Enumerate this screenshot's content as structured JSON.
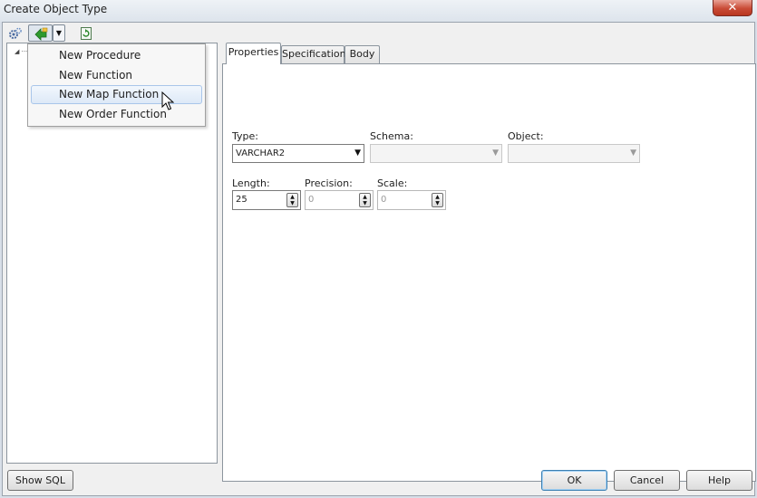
{
  "window": {
    "title": "Create Object Type",
    "close_glyph": "✕"
  },
  "toolbar": {
    "icons": [
      "settings-gear-icon",
      "add-method-icon",
      "dropdown-arrow-icon",
      "refresh-icon"
    ]
  },
  "menu": {
    "items": [
      {
        "label": "New Procedure"
      },
      {
        "label": "New Function"
      },
      {
        "label": "New Map Function"
      },
      {
        "label": "New Order Function"
      }
    ],
    "hovered_index": 2
  },
  "tabs": [
    {
      "label": "Properties",
      "active": true
    },
    {
      "label": "Specification",
      "active": false
    },
    {
      "label": "Body",
      "active": false
    }
  ],
  "properties": {
    "type_label": "Type:",
    "type_value": "VARCHAR2",
    "schema_label": "Schema:",
    "schema_value": "",
    "object_label": "Object:",
    "object_value": "",
    "length_label": "Length:",
    "length_value": "25",
    "precision_label": "Precision:",
    "precision_value": "0",
    "scale_label": "Scale:",
    "scale_value": "0"
  },
  "buttons": {
    "show_sql": "Show SQL",
    "ok": "OK",
    "cancel": "Cancel",
    "help": "Help"
  }
}
